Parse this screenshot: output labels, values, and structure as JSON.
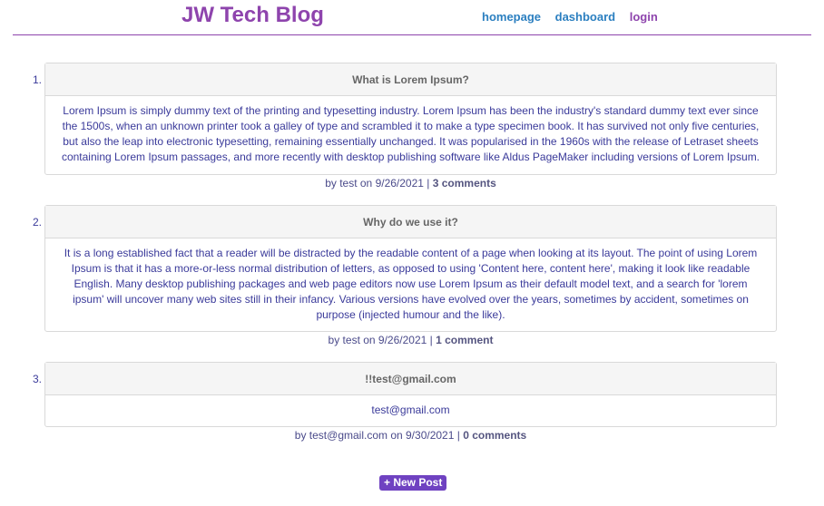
{
  "header": {
    "title": "JW Tech Blog",
    "nav": {
      "homepage": "homepage",
      "dashboard": "dashboard",
      "login": "login"
    }
  },
  "posts": [
    {
      "number": "1.",
      "title": "What is Lorem Ipsum?",
      "body": "Lorem Ipsum is simply dummy text of the printing and typesetting industry. Lorem Ipsum has been the industry's standard dummy text ever since the 1500s, when an unknown printer took a galley of type and scrambled it to make a type specimen book. It has survived not only five centuries, but also the leap into electronic typesetting, remaining essentially unchanged. It was popularised in the 1960s with the release of Letraset sheets containing Lorem Ipsum passages, and more recently with desktop publishing software like Aldus PageMaker including versions of Lorem Ipsum.",
      "byline": "by test on 9/26/2021 |",
      "comments": "3 comments"
    },
    {
      "number": "2.",
      "title": "Why do we use it?",
      "body": "It is a long established fact that a reader will be distracted by the readable content of a page when looking at its layout. The point of using Lorem Ipsum is that it has a more-or-less normal distribution of letters, as opposed to using 'Content here, content here', making it look like readable English. Many desktop publishing packages and web page editors now use Lorem Ipsum as their default model text, and a search for 'lorem ipsum' will uncover many web sites still in their infancy. Various versions have evolved over the years, sometimes by accident, sometimes on purpose (injected humour and the like).",
      "byline": "by test on 9/26/2021 |",
      "comments": "1 comment"
    },
    {
      "number": "3.",
      "title": "!!test@gmail.com",
      "body": "test@gmail.com",
      "byline": "by test@gmail.com on 9/30/2021 |",
      "comments": "0 comments"
    }
  ],
  "new_post_label": "+ New Post",
  "colors": {
    "brand": "#8e44ad",
    "link": "#2b7fc0",
    "button": "#6f42c1"
  }
}
